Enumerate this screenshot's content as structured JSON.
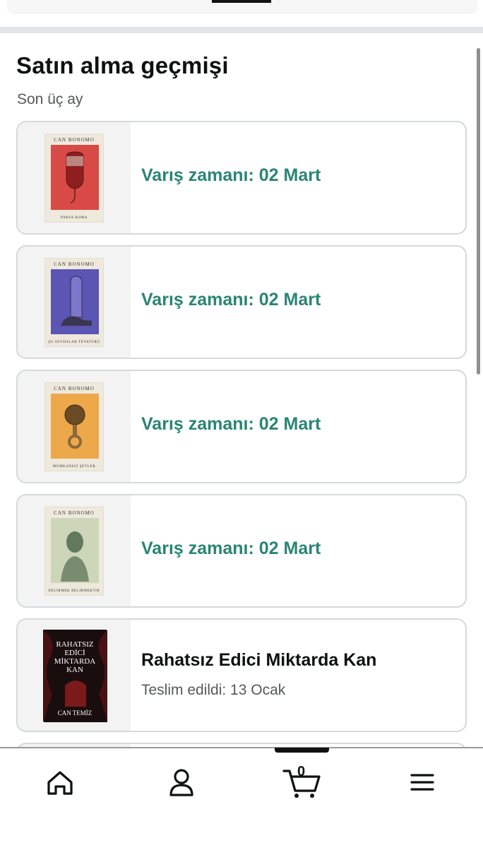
{
  "section": {
    "title": "Satın alma geçmişi",
    "subtitle": "Son üç ay"
  },
  "orders": [
    {
      "status": "Varış zamanı: 02 Mart",
      "cover": {
        "author": "CAN BONOMO",
        "book_title": "PARYA KOMA",
        "color": "#d94a46"
      }
    },
    {
      "status": "Varış zamanı: 02 Mart",
      "cover": {
        "author": "CAN BONOMO",
        "book_title": "ŞU SEVDALAR TEVATÜRÜ",
        "color": "#5b55b3"
      }
    },
    {
      "status": "Varış zamanı: 02 Mart",
      "cover": {
        "author": "CAN BONOMO",
        "book_title": "MÜMKANSIZ ŞEYLER",
        "color": "#eda84a"
      }
    },
    {
      "status": "Varış zamanı: 02 Mart",
      "cover": {
        "author": "CAN BONOMO",
        "book_title": "DELİRMEK BELİRMEKTİR",
        "color": "#cdd6b8"
      }
    },
    {
      "title": "Rahatsız Edici Miktarda Kan",
      "delivered": "Teslim edildi: 13 Ocak",
      "cover": {
        "line1": "RAHATSIZ",
        "line2": "EDİCİ",
        "line3": "MİKTARDA",
        "line4": "KAN",
        "author": "CAN TEMİZ",
        "color": "#1a0d0d"
      }
    }
  ],
  "nav": {
    "cart_count": "0",
    "items": [
      "home-icon",
      "account-icon",
      "cart-icon",
      "menu-icon"
    ]
  },
  "colors": {
    "status_green": "#2a8574",
    "border": "#d5d9d9"
  }
}
